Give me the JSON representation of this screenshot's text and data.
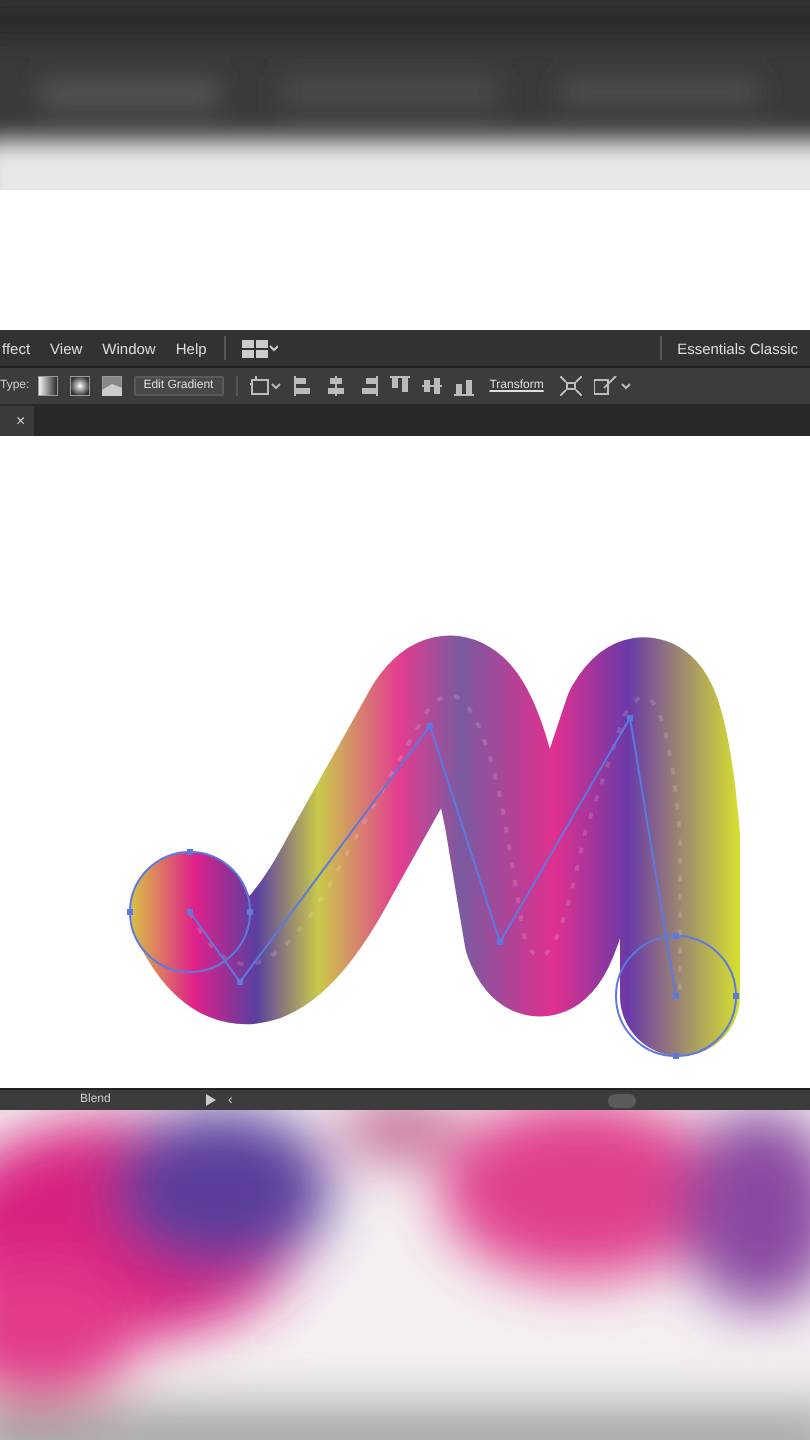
{
  "menu_bar": {
    "items": [
      "ffect",
      "View",
      "Window",
      "Help"
    ],
    "workspace": "Essentials Classic"
  },
  "control_bar": {
    "type_label": "Type:",
    "edit_button": "Edit Gradient",
    "transform_button": "Transform"
  },
  "document_tab": {
    "close": "×"
  },
  "status_bar": {
    "tool": "Blend",
    "back": "‹"
  }
}
